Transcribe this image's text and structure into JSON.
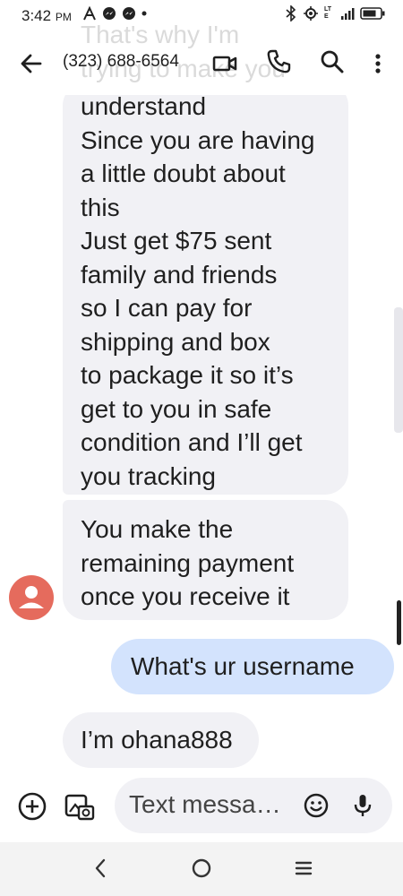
{
  "status_bar": {
    "time": "3:42",
    "ampm": "PM",
    "left_icons": [
      "a-icon",
      "messenger-icon",
      "messenger-icon",
      "dot-icon"
    ],
    "right_icons": [
      "bluetooth-icon",
      "location-icon",
      "lte-icon",
      "signal-icon",
      "battery-icon"
    ],
    "lte_label": "LTE"
  },
  "header": {
    "contact": "(323) 688-6564",
    "icons": [
      "back-arrow-icon",
      "video-icon",
      "phone-icon",
      "search-icon",
      "more-vert-icon"
    ],
    "ghost_line1": "That's why I'm",
    "ghost_line2": "trying to make you"
  },
  "messages": [
    {
      "direction": "incoming",
      "lines": [
        "understand",
        "Since you are having",
        "a little doubt about",
        "this",
        "Just get $75 sent",
        "family and friends",
        "so I can pay for",
        "shipping and box",
        "to package it so it’s",
        "get to you in safe",
        "condition and I’ll get",
        "you tracking"
      ]
    },
    {
      "direction": "incoming",
      "lines": [
        "You make the",
        "remaining payment",
        "once you receive it"
      ]
    },
    {
      "direction": "outgoing",
      "lines": [
        "What's ur username"
      ]
    },
    {
      "direction": "incoming",
      "lines": [
        "I’m ohana888"
      ]
    }
  ],
  "compose": {
    "placeholder": "Text messa…",
    "icons": [
      "add-icon",
      "gallery-icon",
      "emoji-icon",
      "mic-icon"
    ]
  },
  "nav": {
    "icons": [
      "nav-back-icon",
      "home-icon",
      "recents-icon"
    ]
  },
  "colors": {
    "incoming_bubble": "#f1f1f5",
    "outgoing_bubble": "#d3e3fd",
    "avatar": "#e56b5d"
  }
}
